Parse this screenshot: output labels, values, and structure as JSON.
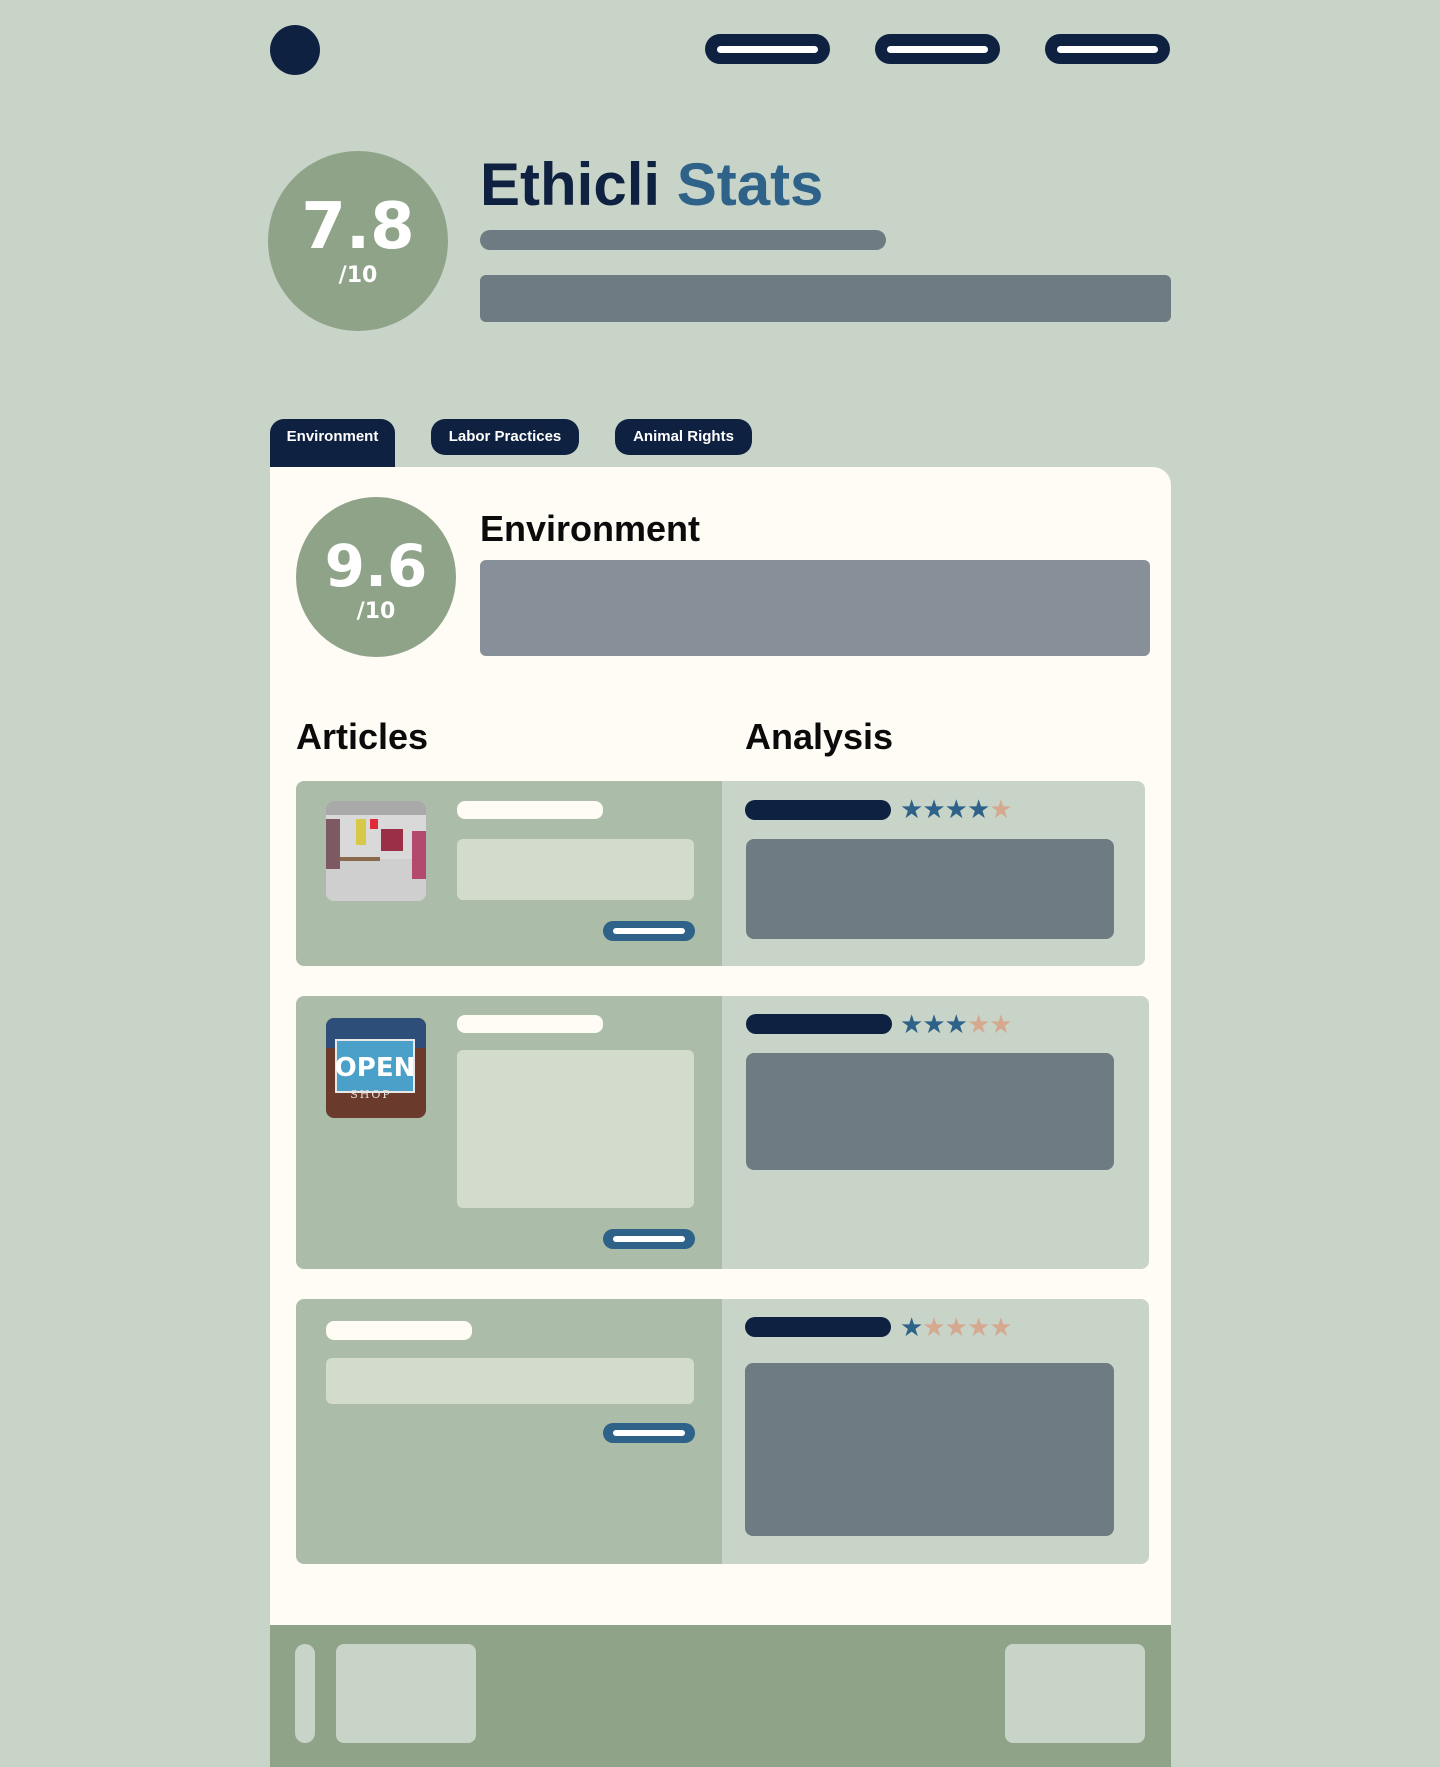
{
  "header": {
    "logo_icon": "logo-circle-icon",
    "nav_count": 3
  },
  "hero": {
    "overall_score": "7.8",
    "overall_scale": "/10",
    "title_part1": "Ethicli",
    "title_part2": "Stats",
    "colors": {
      "navy": "#0f2140",
      "accent_blue": "#2e6289",
      "sage": "#8fa388"
    }
  },
  "tabs": [
    {
      "label": "Environment",
      "active": true
    },
    {
      "label": "Labor Practices",
      "active": false
    },
    {
      "label": "Animal Rights",
      "active": false
    }
  ],
  "category": {
    "score": "9.6",
    "scale": "/10",
    "title": "Environment"
  },
  "sections": {
    "articles_heading": "Articles",
    "analysis_heading": "Analysis"
  },
  "rows": [
    {
      "thumbnail": "clothing-store-photo",
      "rating": 4,
      "max_rating": 5
    },
    {
      "thumbnail": "open-shop-sign-photo",
      "thumbnail_text": "OPEN",
      "thumbnail_subtext": "SHOP",
      "rating": 3,
      "max_rating": 5
    },
    {
      "thumbnail": null,
      "rating": 1,
      "max_rating": 5
    }
  ]
}
